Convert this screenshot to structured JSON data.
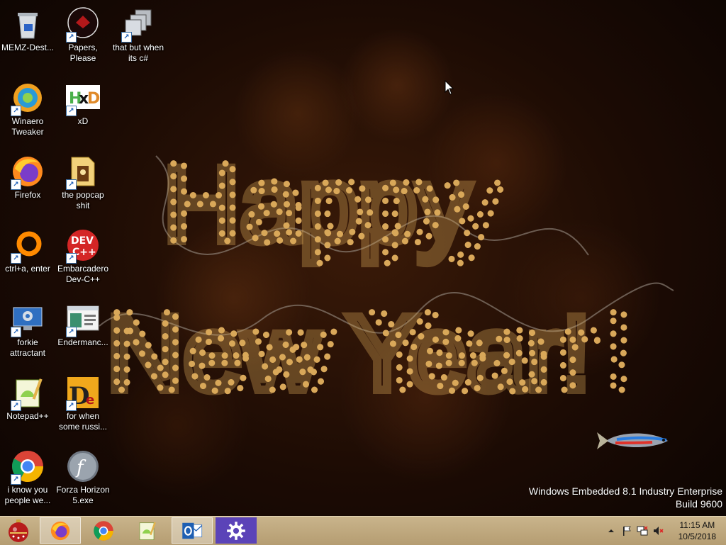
{
  "desktop": {
    "icons": [
      {
        "id": "recycle",
        "label": "MEMZ-Dest..."
      },
      {
        "id": "papers",
        "label": "Papers, Please"
      },
      {
        "id": "cs",
        "label": "that but when its c#"
      },
      {
        "id": "winaero",
        "label": "Winaero Tweaker"
      },
      {
        "id": "xd",
        "label": "xD"
      },
      {
        "id": "firefox",
        "label": "Firefox"
      },
      {
        "id": "popcap",
        "label": "the popcap shit"
      },
      {
        "id": "ctrla",
        "label": "ctrl+a, enter"
      },
      {
        "id": "devcpp",
        "label": "Embarcadero Dev-C++"
      },
      {
        "id": "forkie",
        "label": "forkie attractant"
      },
      {
        "id": "enderman",
        "label": "Endermanc..."
      },
      {
        "id": "notepadpp",
        "label": "Notepad++"
      },
      {
        "id": "russi",
        "label": "for when some russi..."
      },
      {
        "id": "chrome",
        "label": "i know you people we..."
      },
      {
        "id": "forza",
        "label": "Forza Horizon 5.exe"
      }
    ],
    "icon_names": {
      "recycle": "recycle-bin-icon",
      "papers": "papers-please-icon",
      "cs": "stacked-windows-icon",
      "winaero": "winaero-icon",
      "xd": "hxd-icon",
      "firefox": "firefox-icon",
      "popcap": "folder-icon",
      "ctrla": "orange-ring-icon",
      "devcpp": "dev-cpp-icon",
      "forkie": "computer-settings-icon",
      "enderman": "window-app-icon",
      "notepadpp": "notepad-plus-plus-icon",
      "russi": "delphi-icon",
      "chrome": "chrome-icon",
      "forza": "flash-icon"
    },
    "wallpaper": {
      "line1": "Happy",
      "line2": "New Year!",
      "light_color": "#d9a85a"
    },
    "watermark": {
      "edition": "Windows Embedded 8.1 Industry Enterprise",
      "build": "Build 9600"
    }
  },
  "taskbar": {
    "start_icon": "ornament-start-icon",
    "apps": [
      {
        "name": "firefox-taskbar-button",
        "icon": "firefox-icon",
        "active": true
      },
      {
        "name": "chrome-taskbar-button",
        "icon": "chrome-icon",
        "active": false
      },
      {
        "name": "notepadpp-taskbar-button",
        "icon": "notepad-plus-plus-icon",
        "active": false
      },
      {
        "name": "outlook-taskbar-button",
        "icon": "outlook-icon",
        "active": true
      },
      {
        "name": "settings-taskbar-button",
        "icon": "gear-icon",
        "active": false
      }
    ],
    "tray": {
      "icons": [
        "chevron-up-icon",
        "flag-icon",
        "network-icon",
        "speaker-muted-icon"
      ],
      "time": "11:15 AM",
      "date": "10/5/2018"
    }
  }
}
